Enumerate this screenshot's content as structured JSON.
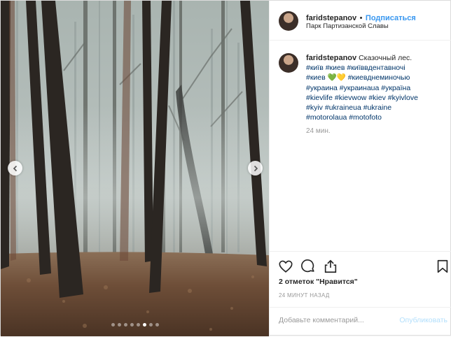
{
  "post": {
    "username": "faridstepanov",
    "separator": "•",
    "follow_label": "Подписаться",
    "location": "Парк Партизанской Славы",
    "caption": "Сказочный лес.",
    "hashtag_lines": [
      [
        "#київ",
        "#киев",
        "#київвдентавночі"
      ],
      [
        "#киев",
        "💚💛",
        "#киевднеминочью"
      ],
      [
        "#украина",
        "#украинаua",
        "#україна"
      ],
      [
        "#kievlife",
        "#kievwow",
        "#kiev",
        "#kyivlove"
      ],
      [
        "#kyiv",
        "#ukraineua",
        "#ukraine"
      ],
      [
        "#motorolaua",
        "#motofoto"
      ]
    ],
    "comment_time": "24 мин.",
    "likes": "2 отметок \"Нравится\"",
    "time_ago": "24 МИНУТ НАЗАД",
    "add_comment_placeholder": "Добавьте комментарий...",
    "publish_label": "Опубликовать",
    "carousel": {
      "total": 8,
      "active": 6
    }
  },
  "icons": {
    "prev": "chevron-left-icon",
    "next": "chevron-right-icon",
    "like": "heart-icon",
    "comment": "comment-icon",
    "share": "share-icon",
    "save": "bookmark-icon"
  },
  "colors": {
    "link": "#3897f0",
    "hashtag": "#003569",
    "muted": "#999999",
    "publish_disabled": "#b2dffc"
  }
}
